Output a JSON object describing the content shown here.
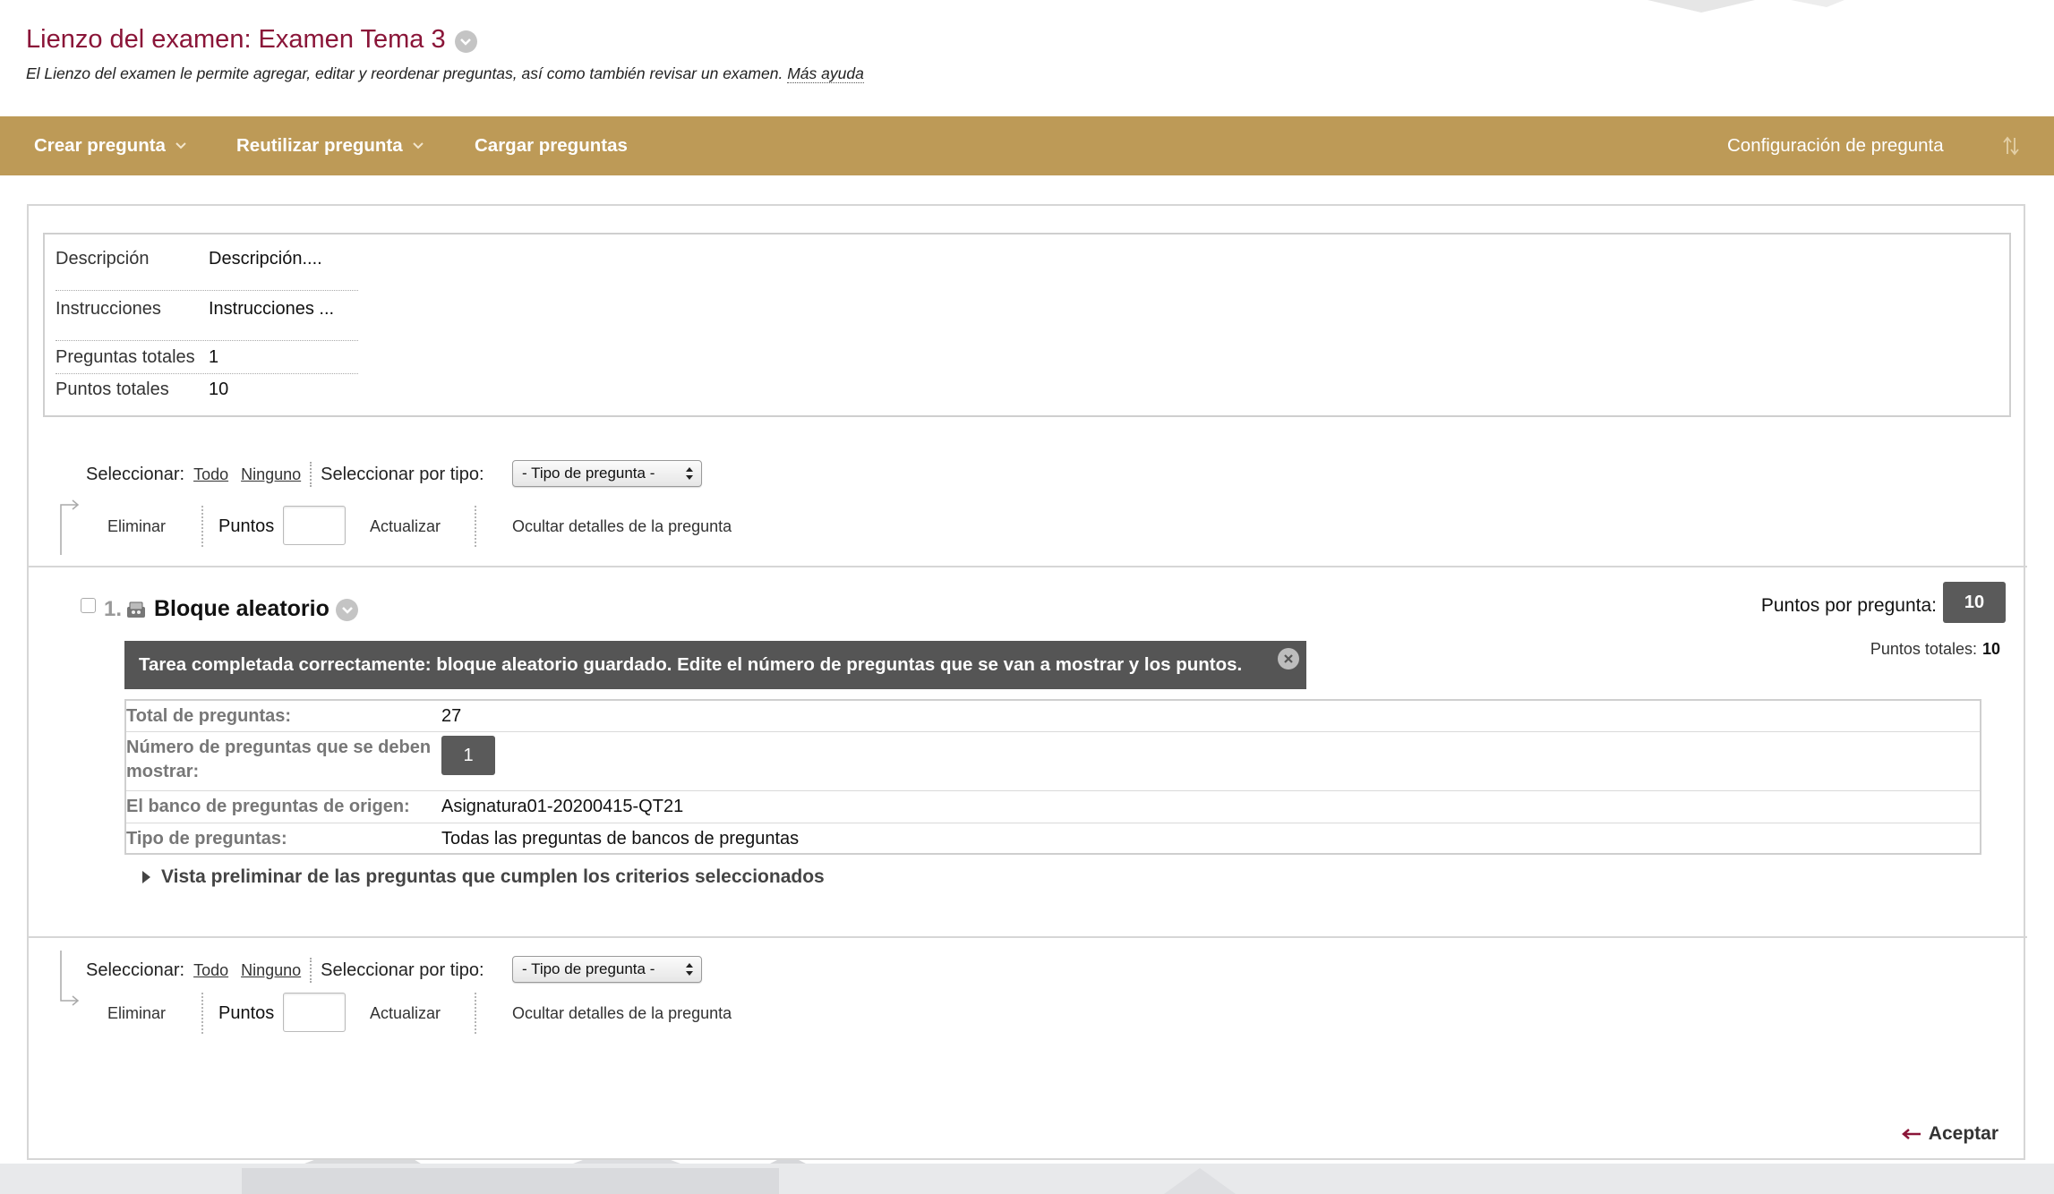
{
  "page": {
    "title": "Lienzo del examen: Examen Tema 3",
    "subtitle": "El Lienzo del examen le permite agregar, editar y reordenar preguntas, así como también revisar un examen.",
    "help_link": "Más ayuda"
  },
  "action_bar": {
    "create_question": "Crear pregunta",
    "reuse_question": "Reutilizar pregunta",
    "upload_questions": "Cargar preguntas",
    "question_settings": "Configuración de pregunta",
    "colors": {
      "bar": "#bd9a57",
      "text": "#ffffff"
    }
  },
  "info": {
    "description_label": "Descripción",
    "description_value": "Descripción....",
    "instructions_label": "Instrucciones",
    "instructions_value": "Instrucciones ...",
    "total_questions_label": "Preguntas totales",
    "total_questions_value": "1",
    "total_points_label": "Puntos totales",
    "total_points_value": "10"
  },
  "selector": {
    "select_label": "Seleccionar:",
    "all": "Todo",
    "none": "Ninguno",
    "by_type_label": "Seleccionar por tipo:",
    "type_select_value": "- Tipo de pregunta -"
  },
  "operations": {
    "delete": "Eliminar",
    "points_label": "Puntos",
    "points_value": "",
    "update": "Actualizar",
    "hide_details": "Ocultar detalles de la pregunta"
  },
  "question": {
    "number": "1.",
    "title": "Bloque aleatorio",
    "points_per_question_label": "Puntos por pregunta:",
    "points_per_question_value": "10",
    "total_points_label": "Puntos totales:",
    "total_points_value": "10",
    "success_message": "Tarea completada correctamente: bloque aleatorio guardado. Edite el número de preguntas que se van a mostrar y los puntos.",
    "details": {
      "total_label": "Total de preguntas:",
      "total_value": "27",
      "num_display_label": "Número de preguntas que se deben mostrar:",
      "num_display_value": "1",
      "source_label": "El banco de preguntas de origen:",
      "source_value": "Asignatura01-20200415-QT21",
      "type_label": "Tipo de preguntas:",
      "type_value": "Todas las preguntas de bancos de preguntas"
    },
    "preview_label": "Vista preliminar de las preguntas que cumplen los criterios seleccionados"
  },
  "footer": {
    "accept": "Aceptar"
  },
  "icons": {
    "title_menu": "chevron-down-icon",
    "sort": "sort-arrows-icon",
    "question_type": "random-block-icon",
    "close": "close-icon",
    "expand": "triangle-right-icon",
    "accept": "arrow-left-icon"
  },
  "colors": {
    "title": "#8a1538",
    "success_bar": "#555555",
    "points_box": "#5a5a5a"
  }
}
